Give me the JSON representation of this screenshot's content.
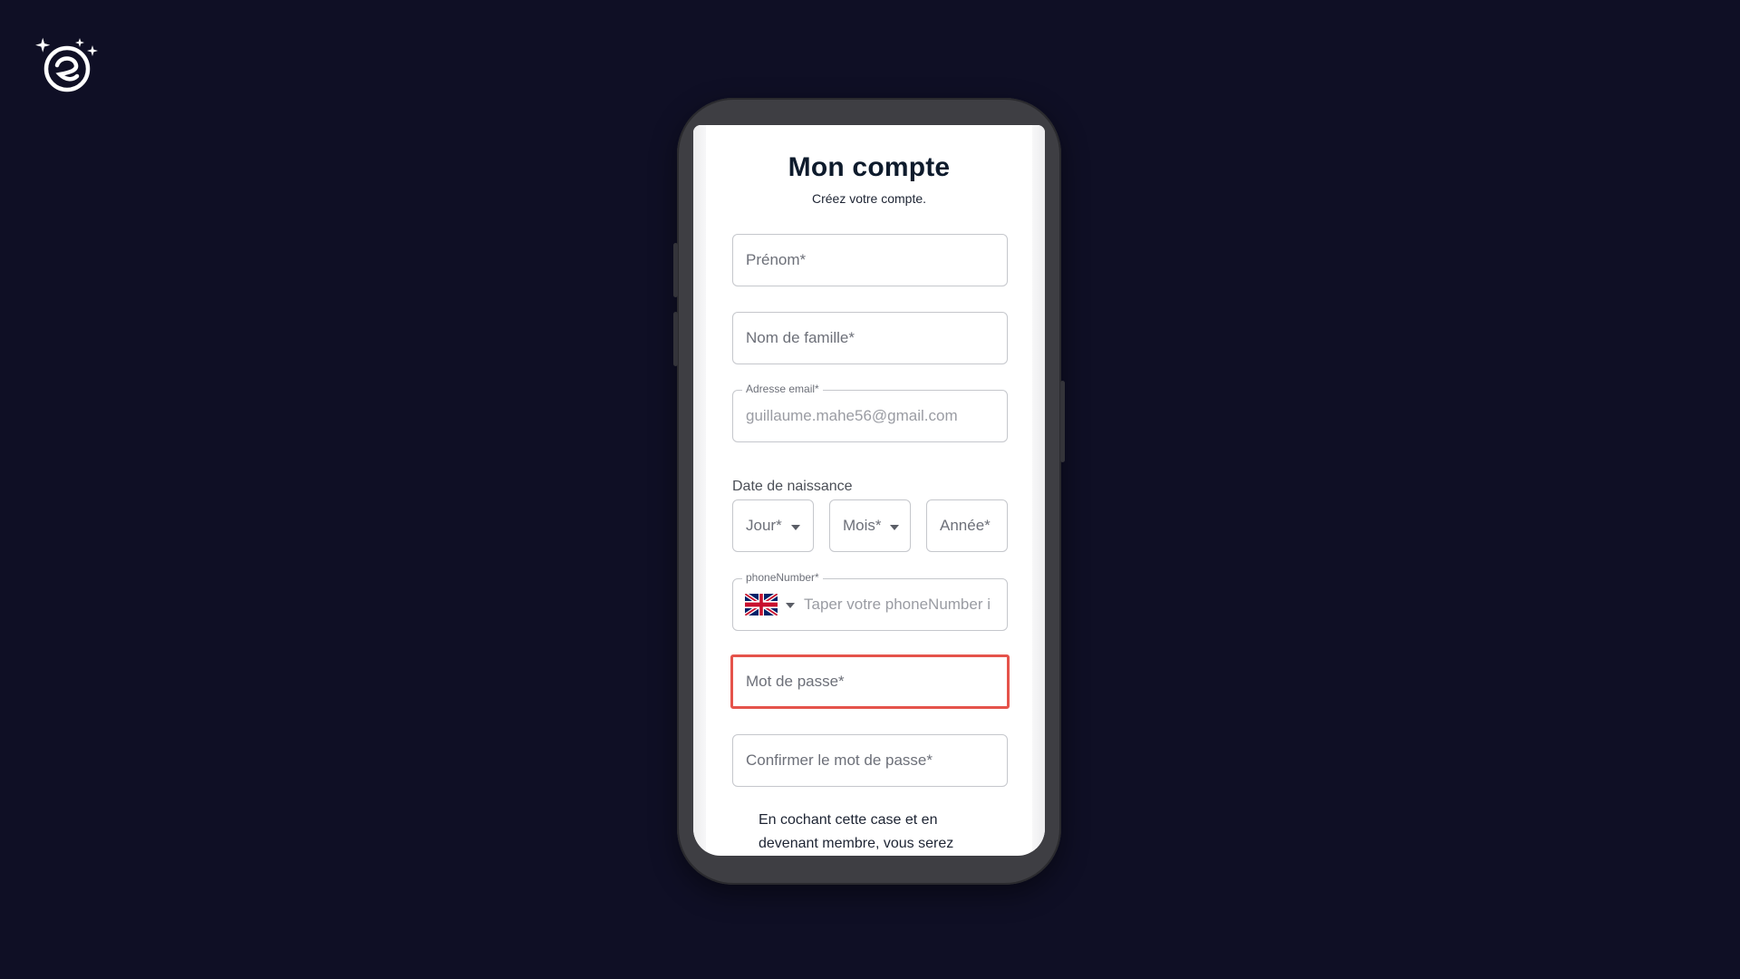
{
  "app": {
    "brand_logo": "spark-circle-logo-icon"
  },
  "page": {
    "title": "Mon compte",
    "subtitle": "Créez votre compte."
  },
  "form": {
    "first_name": {
      "placeholder": "Prénom*"
    },
    "last_name": {
      "placeholder": "Nom de famille*"
    },
    "email": {
      "label": "Adresse email*",
      "value": "guillaume.mahe56@gmail.com"
    },
    "birth_date": {
      "label": "Date de naissance",
      "day": "Jour*",
      "month": "Mois*",
      "year": "Année*"
    },
    "phone": {
      "label": "phoneNumber*",
      "country_flag": "uk-flag-icon",
      "placeholder": "Taper votre phoneNumber i"
    },
    "password": {
      "placeholder": "Mot de passe*",
      "highlight_color": "#e5534b"
    },
    "confirm_password": {
      "placeholder": "Confirmer le mot de passe*"
    },
    "consent_text": "En cochant cette case et en devenant membre, vous serez"
  },
  "colors": {
    "background": "#0f0f25",
    "title": "#0e1b2c",
    "highlight": "#e5534b"
  }
}
